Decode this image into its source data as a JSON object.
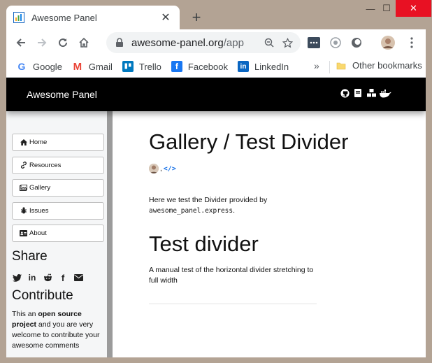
{
  "browser": {
    "tab_title": "Awesome Panel",
    "url_host": "awesome-panel.org",
    "url_path": "/app",
    "bookmarks": [
      {
        "label": "Google",
        "icon": "google-icon"
      },
      {
        "label": "Gmail",
        "icon": "gmail-icon"
      },
      {
        "label": "Trello",
        "icon": "trello-icon"
      },
      {
        "label": "Facebook",
        "icon": "facebook-icon"
      },
      {
        "label": "LinkedIn",
        "icon": "linkedin-icon"
      }
    ],
    "more_bookmarks": "»",
    "other_bookmarks": "Other bookmarks"
  },
  "app": {
    "brand": "Awesome Panel",
    "header_links": [
      "github-icon",
      "book-icon",
      "cubes-icon",
      "docker-icon"
    ]
  },
  "sidebar": {
    "items": [
      {
        "label": "Home",
        "icon": "home-icon"
      },
      {
        "label": "Resources",
        "icon": "link-icon"
      },
      {
        "label": "Gallery",
        "icon": "images-icon"
      },
      {
        "label": "Issues",
        "icon": "bug-icon"
      },
      {
        "label": "About",
        "icon": "id-card-icon"
      }
    ],
    "share_heading": "Share",
    "share_icons": [
      "twitter-icon",
      "linkedin-icon",
      "reddit-icon",
      "facebook-icon",
      "email-icon"
    ],
    "contribute_heading": "Contribute",
    "contribute_text_1": "This an ",
    "contribute_bold": "open source project",
    "contribute_text_2": " and you are very welcome to contribute your awesome comments"
  },
  "main": {
    "title": "Gallery / Test Divider",
    "intro_text": "Here we test the Divider provided by",
    "intro_code": "awesome_panel.express",
    "intro_end": ".",
    "section_heading": "Test divider",
    "description": "A manual test of the horizontal divider stretching to full width"
  },
  "colors": {
    "appbar": "#000000",
    "close_button": "#e81123",
    "link_blue": "#1a73e8"
  }
}
